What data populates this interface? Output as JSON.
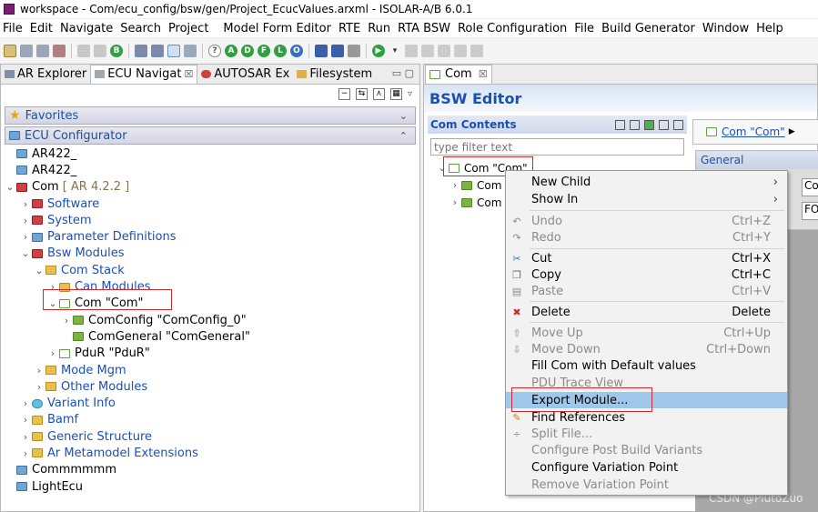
{
  "window": {
    "title": "workspace - Com/ecu_config/bsw/gen/Project_EcucValues.arxml - ISOLAR-A/B 6.0.1"
  },
  "menubar": [
    "File",
    "Edit",
    "Navigate",
    "Search",
    "Project",
    "Model Form Editor",
    "RTE",
    "Run",
    "RTA BSW",
    "Role Configuration",
    "File",
    "Build Generator",
    "Window",
    "Help"
  ],
  "toolbar": {
    "circle_labels": [
      "B",
      "A",
      "D",
      "F",
      "L",
      "O"
    ]
  },
  "left_tabs": [
    "AR Explorer",
    "ECU Navigat",
    "AUTOSAR Ex",
    "Filesystem"
  ],
  "left_tab_close": "☒",
  "sections": {
    "favorites": "Favorites",
    "ecu_configurator": "ECU Configurator"
  },
  "tree": {
    "ar1": "AR422_",
    "ar2": "AR422_",
    "com_root": "Com",
    "com_root_version": "[ AR 4.2.2 ]",
    "software": "Software",
    "system": "System",
    "param_defs": "Parameter Definitions",
    "bsw_modules": "Bsw Modules",
    "com_stack": "Com Stack",
    "can_modules": "Can Modules",
    "com_module": "Com \"Com\"",
    "com_config": "ComConfig \"ComConfig_0\"",
    "com_general": "ComGeneral \"ComGeneral\"",
    "pdur": "PduR \"PduR\"",
    "mode_mgm": "Mode Mgm",
    "other_modules": "Other Modules",
    "variant_info": "Variant Info",
    "bamf": "Bamf",
    "generic_structure": "Generic Structure",
    "ar_metamodel": "Ar Metamodel Extensions",
    "commmmmm": "Commmmmm",
    "lightecu": "LightEcu"
  },
  "right": {
    "tab": "Com",
    "tab_close": "☒",
    "editor_title": "BSW Editor",
    "contents_title": "Com Contents",
    "filter_placeholder": "type filter text",
    "rtree_root": "Com \"Com\"",
    "rtree_child1": "Com",
    "rtree_child2": "Com",
    "link": "Com \"Com\"",
    "general": "General",
    "field1": "Co",
    "field2": "FO"
  },
  "context_menu": {
    "new_child": "New Child",
    "show_in": "Show In",
    "undo": "Undo",
    "undo_sc": "Ctrl+Z",
    "redo": "Redo",
    "redo_sc": "Ctrl+Y",
    "cut": "Cut",
    "cut_sc": "Ctrl+X",
    "copy": "Copy",
    "copy_sc": "Ctrl+C",
    "paste": "Paste",
    "paste_sc": "Ctrl+V",
    "delete": "Delete",
    "delete_sc": "Delete",
    "move_up": "Move Up",
    "move_up_sc": "Ctrl+Up",
    "move_down": "Move Down",
    "move_down_sc": "Ctrl+Down",
    "fill_defaults": "Fill Com with Default values",
    "pdu_trace": "PDU Trace View",
    "export_module": "Export Module...",
    "find_references": "Find References",
    "split_file": "Split File...",
    "config_post_build": "Configure Post Build Variants",
    "config_variation_point": "Configure Variation Point",
    "remove_variation_point": "Remove Variation Point"
  },
  "watermark": "CSDN @PlutoZuo",
  "colors": {
    "accent": "#1a4fb4",
    "highlight": "#9fc7ea",
    "annotation": "#d0282c"
  }
}
